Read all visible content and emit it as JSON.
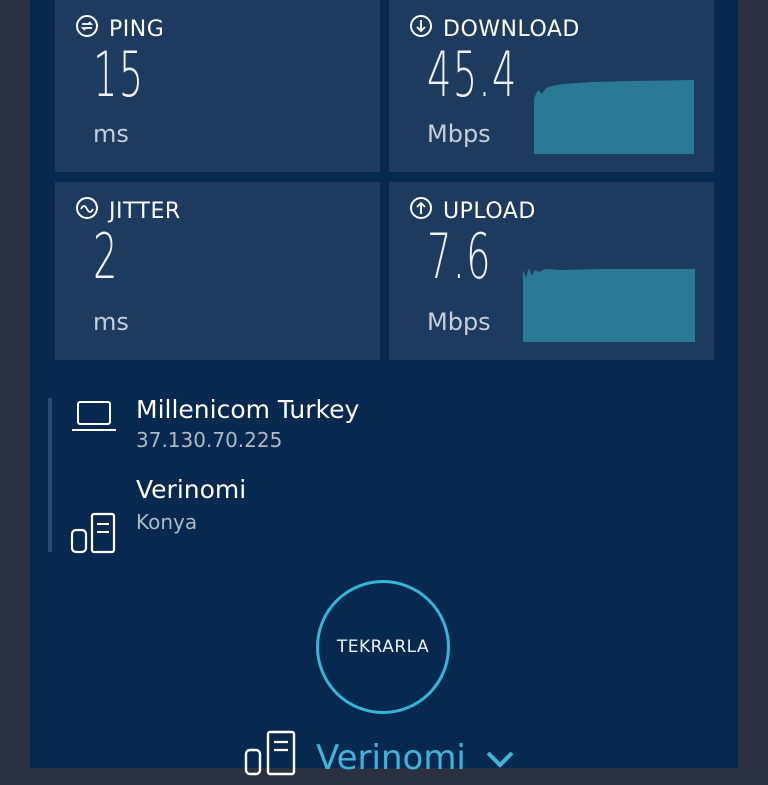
{
  "metrics": {
    "ping": {
      "label": "PING",
      "value": "15",
      "unit": "ms",
      "icon": "ping-icon"
    },
    "download": {
      "label": "DOWNLOAD",
      "value": "45.4",
      "unit": "Mbps",
      "icon": "download-arrow-icon"
    },
    "jitter": {
      "label": "JITTER",
      "value": "2",
      "unit": "ms",
      "icon": "jitter-icon"
    },
    "upload": {
      "label": "UPLOAD",
      "value": "7.6",
      "unit": "Mbps",
      "icon": "upload-arrow-icon"
    }
  },
  "connection": {
    "isp_name": "Millenicom Turkey",
    "ip": "37.130.70.225",
    "server_name": "Verinomi",
    "server_location": "Konya"
  },
  "actions": {
    "again_label": "TEKRARLA"
  },
  "bottom": {
    "server_label": "Verinomi"
  },
  "colors": {
    "panel": "#07284f",
    "card": "#1c3b5f",
    "accent": "#36b6d6",
    "graph": "#2a7a96"
  }
}
